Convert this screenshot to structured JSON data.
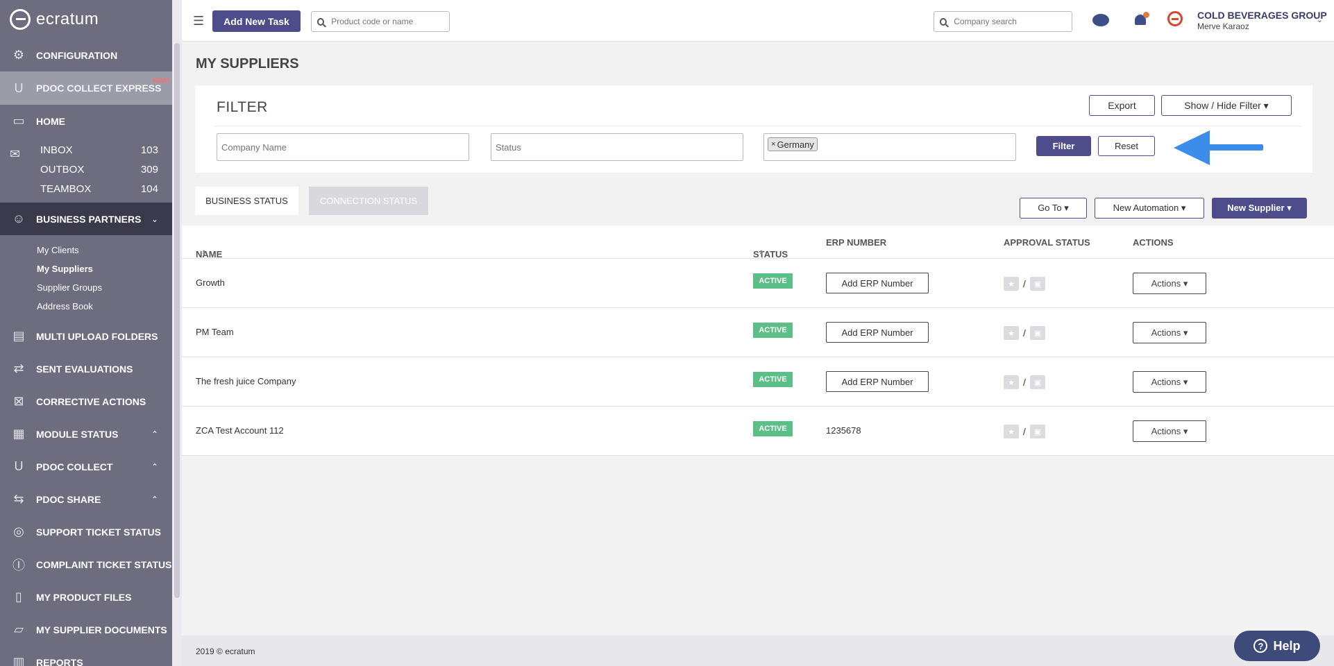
{
  "brand": {
    "logo_text": "ecratum"
  },
  "sidebar": {
    "configuration": "CONFIGURATION",
    "pdoc_collect_express": "PDOC COLLECT EXPRESS",
    "new_tag": "NEW!",
    "home": "HOME",
    "mail": [
      {
        "label": "INBOX",
        "count": "103"
      },
      {
        "label": "OUTBOX",
        "count": "309"
      },
      {
        "label": "TEAMBOX",
        "count": "104"
      }
    ],
    "business_partners": "BUSINESS PARTNERS",
    "business_partners_sub": [
      "My Clients",
      "My Suppliers",
      "Supplier Groups",
      "Address Book"
    ],
    "multi_upload": "MULTI UPLOAD FOLDERS",
    "sent_evaluations": "SENT EVALUATIONS",
    "corrective_actions": "CORRECTIVE ACTIONS",
    "module_status": "MODULE STATUS",
    "pdoc_collect": "PDOC COLLECT",
    "pdoc_share": "PDOC SHARE",
    "support_ticket": "SUPPORT TICKET STATUS",
    "complaint_ticket": "COMPLAINT TICKET STATUS",
    "product_files": "MY PRODUCT FILES",
    "supplier_documents": "MY SUPPLIER DOCUMENTS",
    "reports": "REPORTS"
  },
  "topbar": {
    "add_task": "Add New Task",
    "product_search_placeholder": "Product code or name",
    "company_search_placeholder": "Company search",
    "company_name": "COLD BEVERAGES GROUP",
    "user_name": "Merve Karaoz"
  },
  "page": {
    "title": "MY SUPPLIERS",
    "filter": {
      "title": "FILTER",
      "export": "Export",
      "show_hide": "Show / Hide Filter",
      "company_placeholder": "Company Name",
      "status_placeholder": "Status",
      "country_tag": "Germany",
      "filter_btn": "Filter",
      "reset_btn": "Reset"
    },
    "tabs": {
      "business": "BUSINESS STATUS",
      "connection": "CONNECTION STATUS"
    },
    "toolbar": {
      "goto": "Go To",
      "automation": "New Automation",
      "new_supplier": "New Supplier"
    },
    "table": {
      "columns": {
        "name": "NAME",
        "status": "STATUS",
        "erp": "ERP NUMBER",
        "approval": "APPROVAL STATUS",
        "actions": "ACTIONS"
      },
      "rows": [
        {
          "name": "Growth",
          "status": "ACTIVE",
          "erp": "Add ERP Number",
          "erp_is_button": true,
          "actions": "Actions"
        },
        {
          "name": "PM Team",
          "status": "ACTIVE",
          "erp": "Add ERP Number",
          "erp_is_button": true,
          "actions": "Actions"
        },
        {
          "name": "The fresh juice Company",
          "status": "ACTIVE",
          "erp": "Add ERP Number",
          "erp_is_button": true,
          "actions": "Actions"
        },
        {
          "name": "ZCA Test Account 112",
          "status": "ACTIVE",
          "erp": "1235678",
          "erp_is_button": false,
          "actions": "Actions"
        }
      ]
    },
    "footer": "2019 © ecratum",
    "help": "Help"
  },
  "colors": {
    "sidebar": "#6e6d80",
    "primary": "#4e4c8a",
    "active_badge": "#5cbf87",
    "arrow": "#3c8de9"
  }
}
